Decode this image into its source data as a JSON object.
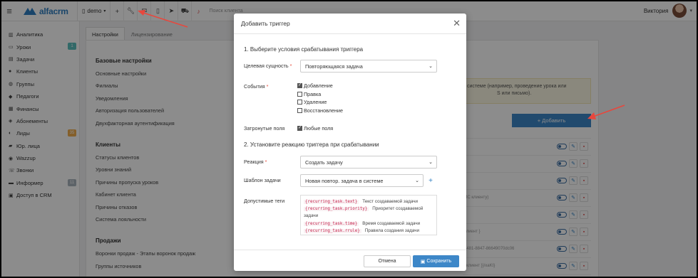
{
  "brand": {
    "name": "alfacrm",
    "accent": "#2f7fc1",
    "overlay_color": "#000000"
  },
  "topbar": {
    "branch": "demo",
    "search_placeholder": "Поиск клиента",
    "user_name": "Виктория",
    "icons": [
      "menu-icon",
      "branch-icon",
      "plus-icon",
      "wrench-icon",
      "mail-icon",
      "phone-icon",
      "telegram-icon",
      "cart-icon",
      "bell-icon"
    ]
  },
  "sidebar": {
    "items": [
      {
        "label": "Аналитика",
        "icon": "chart-icon"
      },
      {
        "label": "Уроки",
        "icon": "calendar-icon",
        "badge": "1",
        "badge_color": "#5bc0be"
      },
      {
        "label": "Задачи",
        "icon": "tasks-icon"
      },
      {
        "label": "Клиенты",
        "icon": "user-icon"
      },
      {
        "label": "Группы",
        "icon": "users-icon"
      },
      {
        "label": "Педагоги",
        "icon": "teacher-icon"
      },
      {
        "label": "Финансы",
        "icon": "money-icon"
      },
      {
        "label": "Абонементы",
        "icon": "tag-icon"
      },
      {
        "label": "Лиды",
        "icon": "lead-icon",
        "badge": "35",
        "badge_color": "#f0ad4e"
      },
      {
        "label": "Юр. лица",
        "icon": "building-icon"
      },
      {
        "label": "Wazzup",
        "icon": "chat-icon"
      },
      {
        "label": "Звонки",
        "icon": "call-icon"
      },
      {
        "label": "Информер",
        "icon": "informer-icon",
        "badge": "11",
        "badge_color": "#aab4bd"
      },
      {
        "label": "Доступ в CRM",
        "icon": "key-icon"
      }
    ]
  },
  "tabs": [
    {
      "label": "Настройки"
    },
    {
      "label": "Лицензирование"
    }
  ],
  "settings": {
    "groups": [
      {
        "title": "Базовые настройки",
        "items": [
          "Основные настройки",
          "Филиалы",
          "Уведомления",
          "Авторизация пользователей",
          "Двухфакторная аутентификация"
        ]
      },
      {
        "title": "Клиенты",
        "items": [
          "Статусы клиентов",
          "Уровни знаний",
          "Причины пропуска уроков",
          "Кабинет клиента",
          "Причины отказов",
          "Система лояльности"
        ]
      },
      {
        "title": "Продажи",
        "items": [
          "Воронки продаж - Этапы воронок продаж",
          "Группы источников"
        ]
      }
    ]
  },
  "notice": {
    "line1": "системе (например, проведение урока или",
    "line2": "S или письмо)."
  },
  "add_button": {
    "label": "+ Добавить"
  },
  "rows": [
    {
      "text": "",
      "on": false
    },
    {
      "text": "",
      "on": false
    },
    {
      "text": "",
      "on": false
    },
    {
      "text": "ИС клиенту)",
      "on": false
    },
    {
      "text": "",
      "on": false
    },
    {
      "text": "клиент }",
      "on": false
    },
    {
      "text": "4481-8847-86649070dc06",
      "on": false
    },
    {
      "text": "уклиент }}/xaKt}",
      "on": false
    },
    {
      "text": "МЅ клиенту))",
      "on": true
    }
  ],
  "modal": {
    "title": "Добавить триггер",
    "section1": "1. Выберите условия срабатывания триггера",
    "entity_label": "Целевая сущность",
    "entity_value": "Повторяющаяся задача",
    "events_label": "События",
    "events": [
      {
        "label": "Добавление",
        "checked": true
      },
      {
        "label": "Правка",
        "checked": false
      },
      {
        "label": "Удаление",
        "checked": false
      },
      {
        "label": "Восстановление",
        "checked": false
      }
    ],
    "fields_label": "Затронутые поля",
    "fields_value": "Любые поля",
    "section2": "2. Установите реакцию триггера при срабатывании",
    "reaction_label": "Реакция",
    "reaction_value": "Создать задачу",
    "template_label": "Шаблон задачи",
    "template_value": "Новая повтор. задача в системе",
    "tags_label": "Допустимые теги",
    "tags": [
      {
        "code": "{recurring_task.text}",
        "desc": "Текст создаваемой задачи"
      },
      {
        "code": "{recurring_task.priority}",
        "desc": "Приоритет создаваемой"
      },
      {
        "code": "",
        "desc": "задачи"
      },
      {
        "code": "{recurring_task.time}",
        "desc": "Время создаваемой задачи"
      },
      {
        "code": "{recurring_task.rrule}",
        "desc": "Правила создания задачи"
      }
    ],
    "cancel_label": "Отмена",
    "save_label": "Сохранить"
  },
  "annotation_color": "#e8473d"
}
